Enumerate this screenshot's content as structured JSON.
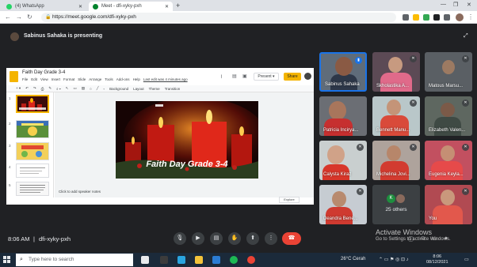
{
  "browser": {
    "tabs": [
      {
        "label": "(4) WhatsApp"
      },
      {
        "label": "Meet - dfi-xyky-pxh"
      }
    ],
    "new_tab": "+",
    "url": "https://meet.google.com/dfi-xyky-pxh"
  },
  "meet": {
    "presenting_text": "Sabinus Sahaka is presenting",
    "meeting_time": "8:06 AM",
    "meeting_code": "dfi-xyky-pxh",
    "participants": [
      {
        "name": "Sabinus Sahaka"
      },
      {
        "name": "Skholastika A..."
      },
      {
        "name": "Matous Marsu..."
      },
      {
        "name": "Patricia Incirya..."
      },
      {
        "name": "Bennett Manu..."
      },
      {
        "name": "Elizabeth Valen..."
      },
      {
        "name": "Calysta Kiraz"
      },
      {
        "name": "Michelina Jovi..."
      },
      {
        "name": "Eugenia Keyla..."
      },
      {
        "name": "Deandra Bene..."
      },
      {
        "name": "25 others"
      },
      {
        "name": "You"
      }
    ],
    "others_avatar_letter": "K"
  },
  "slides": {
    "doc_title": "Faith Day Grade 3-4",
    "menu": [
      "File",
      "Edit",
      "View",
      "Insert",
      "Format",
      "Slide",
      "Arrange",
      "Tools",
      "Add-ons",
      "Help"
    ],
    "last_edit": "Last edit was 4 minutes ago",
    "present_label": "Present",
    "share_label": "Share",
    "toolbar_items": [
      "Background",
      "Layout",
      "Theme",
      "Transition"
    ],
    "slide_title": "Faith Day Grade 3-4",
    "notes_placeholder": "Click to add speaker notes",
    "explore_label": "Explore",
    "thumb_numbers": [
      "1",
      "2",
      "3",
      "4",
      "5"
    ]
  },
  "windows": {
    "activate_title": "Activate Windows",
    "activate_sub": "Go to Settings to activate Windows.",
    "search_placeholder": "Type here to search",
    "weather": "26°C  Cerah",
    "time": "8:06",
    "date": "08/12/2021"
  },
  "colors": {
    "meet_bg": "#202124",
    "end_call": "#ea4335",
    "accent_blue": "#1a73e8",
    "slides_yellow": "#f4b400"
  }
}
